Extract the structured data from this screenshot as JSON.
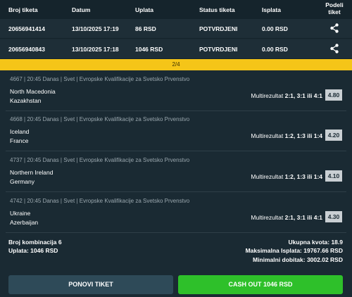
{
  "header": {
    "col_ticket": "Broj tiketa",
    "col_date": "Datum",
    "col_payment": "Uplata",
    "col_status": "Status tiketa",
    "col_payout": "Isplata",
    "col_share_line1": "Podeli",
    "col_share_line2": "tiket"
  },
  "tickets": [
    {
      "id": "20656941414",
      "date": "13/10/2025 17:19",
      "payment": "86 RSD",
      "status": "POTVRDJENI",
      "payout": "0.00 RSD",
      "icon": "share-icon"
    },
    {
      "id": "20656940843",
      "date": "13/10/2025 17:18",
      "payment": "1046 RSD",
      "status": "POTVRDJENI",
      "payout": "0.00 RSD",
      "icon": "share-icon"
    }
  ],
  "pager": "2/4",
  "matches": [
    {
      "meta": "4667 | 20:45 Danas | Svet | Evropske Kvalifikacije za Svetsko Prvenstvo",
      "team1": "North Macedonia",
      "team2": "Kazakhstan",
      "pick_label": "Multirezultat",
      "pick_value": "2:1, 3:1 ili 4:1",
      "odd": "4.80"
    },
    {
      "meta": "4668 | 20:45 Danas | Svet | Evropske Kvalifikacije za Svetsko Prvenstvo",
      "team1": "Iceland",
      "team2": "France",
      "pick_label": "Multirezultat",
      "pick_value": "1:2, 1:3 ili 1:4",
      "odd": "4.20"
    },
    {
      "meta": "4737 | 20:45 Danas | Svet | Evropske Kvalifikacije za Svetsko Prvenstvo",
      "team1": "Northern Ireland",
      "team2": "Germany",
      "pick_label": "Multirezultat",
      "pick_value": "1:2, 1:3 ili 1:4",
      "odd": "4.10"
    },
    {
      "meta": "4742 | 20:45 Danas | Svet | Evropske Kvalifikacije za Svetsko Prvenstvo",
      "team1": "Ukraine",
      "team2": "Azerbaijan",
      "pick_label": "Multirezultat",
      "pick_value": "2:1, 3:1 ili 4:1",
      "odd": "4.30"
    }
  ],
  "summary": {
    "combinations": "Broj kombinacija 6",
    "payment": "Uplata: 1046 RSD",
    "total_odds": "Ukupna kvota: 18.9",
    "max_payout": "Maksimalna Isplata: 19767.66 RSD",
    "min_win": "Minimalni dobitak: 3002.02 RSD"
  },
  "buttons": {
    "repeat": "PONOVI TIKET",
    "cashout": "CASH OUT 1046 RSD"
  },
  "colors": {
    "background": "#1a2a33",
    "pager": "#f5c518",
    "cashout": "#2ec02a",
    "repeat": "#2e4a58"
  }
}
